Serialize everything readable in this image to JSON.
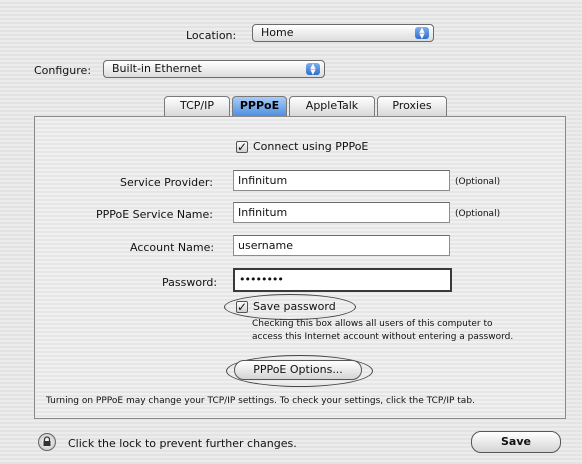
{
  "location": {
    "label": "Location:",
    "value": "Home"
  },
  "configure": {
    "label": "Configure:",
    "value": "Built-in Ethernet"
  },
  "tabs": [
    {
      "label": "TCP/IP"
    },
    {
      "label": "PPPoE"
    },
    {
      "label": "AppleTalk"
    },
    {
      "label": "Proxies"
    }
  ],
  "pppoe": {
    "connect_label": "Connect using PPPoE",
    "service_provider": {
      "label": "Service Provider:",
      "value": "Infinitum",
      "hint": "(Optional)"
    },
    "service_name": {
      "label": "PPPoE Service Name:",
      "value": "Infinitum",
      "hint": "(Optional)"
    },
    "account_name": {
      "label": "Account Name:",
      "value": "username"
    },
    "password": {
      "label": "Password:",
      "value": "••••••••"
    },
    "save_password_label": "Save password",
    "save_note_line1": "Checking this box allows all users of this computer to",
    "save_note_line2": "access this Internet account without entering a password.",
    "options_button": "PPPoE Options...",
    "footer_note": "Turning on PPPoE may change your TCP/IP settings. To check your settings, click the TCP/IP tab."
  },
  "bottom": {
    "lock_text": "Click the lock to prevent further changes.",
    "save_button": "Save"
  },
  "colors": {
    "active_tab": "#4f8fe0",
    "popup_arrow": "#2d6fd0"
  }
}
